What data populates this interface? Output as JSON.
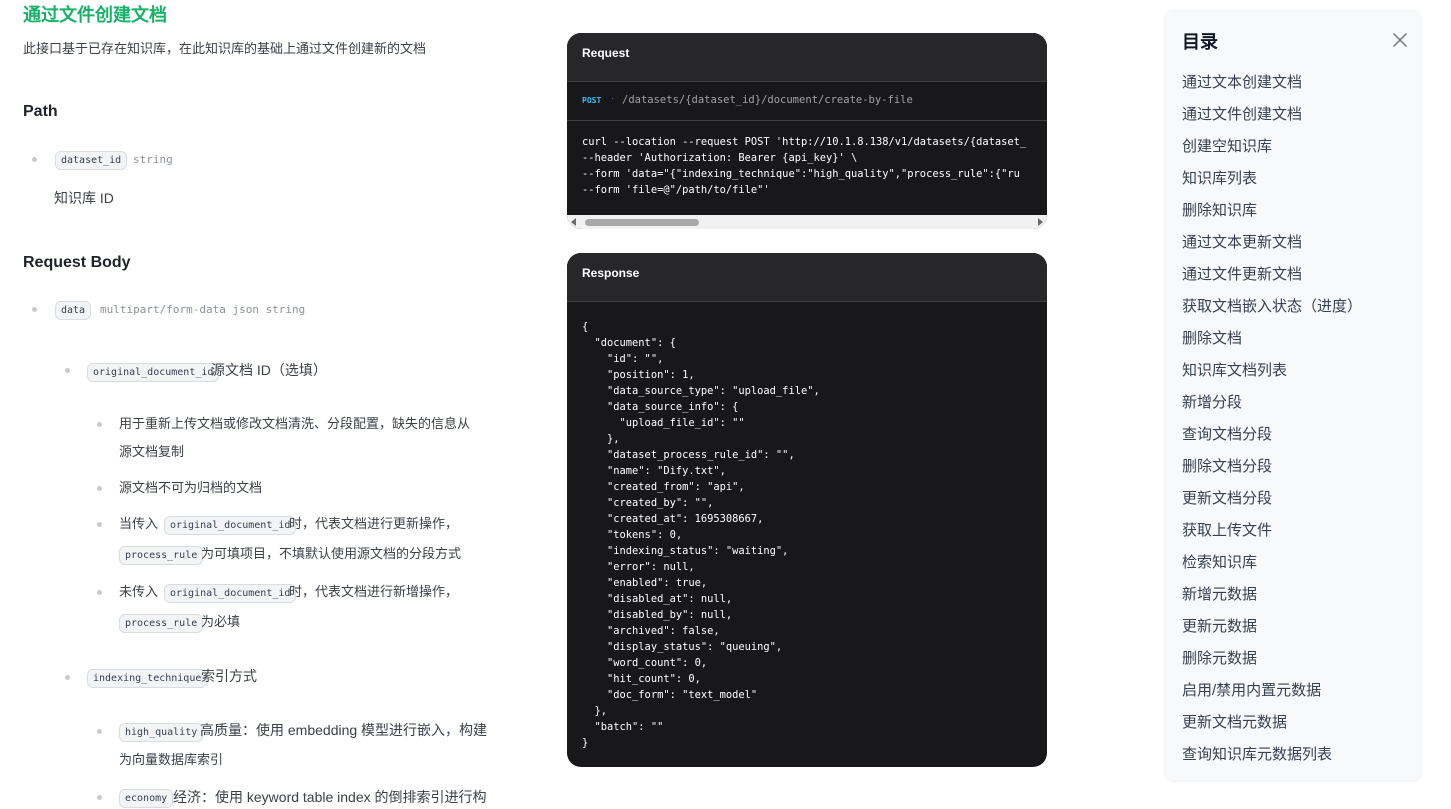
{
  "page": {
    "title": "通过文件创建文档",
    "description": "此接口基于已存在知识库，在此知识库的基础上通过文件创建新的文档"
  },
  "path_section": {
    "heading": "Path",
    "param_name": "dataset_id",
    "param_type": "string",
    "param_desc": "知识库 ID"
  },
  "body_section": {
    "heading": "Request Body",
    "data_name": "data",
    "data_type": "multipart/form-data json string",
    "original_doc": {
      "name": "original_document_id",
      "label": "源文档 ID（选填）",
      "notes": [
        "用于重新上传文档或修改文档清洗、分段配置，缺失的信息从",
        "源文档复制",
        "源文档不可为归档的文档"
      ],
      "when_passed_prefix": "当传入",
      "when_passed_suffix": "时，代表文档进行更新操作，",
      "process_rule_optional": "为可填项目，不填默认使用源文档的分段方式",
      "when_not_prefix": "未传入",
      "when_not_suffix": "时，代表文档进行新增操作，",
      "process_rule_required": "为必填",
      "process_rule_chip": "process_rule"
    },
    "indexing": {
      "name": "indexing_technique",
      "label": "索引方式",
      "high_quality_chip": "high_quality",
      "high_quality_line1": "高质量：使用 embedding 模型进行嵌入，构建",
      "high_quality_line2": "为向量数据库索引",
      "economy_chip": "economy",
      "economy_line1": "经济：使用 keyword table index 的倒排索引进行构"
    }
  },
  "request_panel": {
    "title": "Request",
    "method": "POST",
    "separator": "·",
    "endpoint": "/datasets/{dataset_id}/document/create-by-file",
    "code": "curl --location --request POST 'http://10.1.8.138/v1/datasets/{dataset_\n--header 'Authorization: Bearer {api_key}' \\\n--form 'data=\"{\"indexing_technique\":\"high_quality\",\"process_rule\":{\"ru\n--form 'file=@\"/path/to/file\"'"
  },
  "response_panel": {
    "title": "Response",
    "code": "{\n  \"document\": {\n    \"id\": \"\",\n    \"position\": 1,\n    \"data_source_type\": \"upload_file\",\n    \"data_source_info\": {\n      \"upload_file_id\": \"\"\n    },\n    \"dataset_process_rule_id\": \"\",\n    \"name\": \"Dify.txt\",\n    \"created_from\": \"api\",\n    \"created_by\": \"\",\n    \"created_at\": 1695308667,\n    \"tokens\": 0,\n    \"indexing_status\": \"waiting\",\n    \"error\": null,\n    \"enabled\": true,\n    \"disabled_at\": null,\n    \"disabled_by\": null,\n    \"archived\": false,\n    \"display_status\": \"queuing\",\n    \"word_count\": 0,\n    \"hit_count\": 0,\n    \"doc_form\": \"text_model\"\n  },\n  \"batch\": \"\"\n}"
  },
  "toc": {
    "title": "目录",
    "items": [
      "通过文本创建文档",
      "通过文件创建文档",
      "创建空知识库",
      "知识库列表",
      "删除知识库",
      "通过文本更新文档",
      "通过文件更新文档",
      "获取文档嵌入状态（进度）",
      "删除文档",
      "知识库文档列表",
      "新增分段",
      "查询文档分段",
      "删除文档分段",
      "更新文档分段",
      "获取上传文件",
      "检索知识库",
      "新增元数据",
      "更新元数据",
      "删除元数据",
      "启用/禁用内置元数据",
      "更新文档元数据",
      "查询知识库元数据列表"
    ]
  },
  "colors": {
    "accent": "#17b26a",
    "code_bg": "#18181b",
    "method": "#38bdf8"
  }
}
